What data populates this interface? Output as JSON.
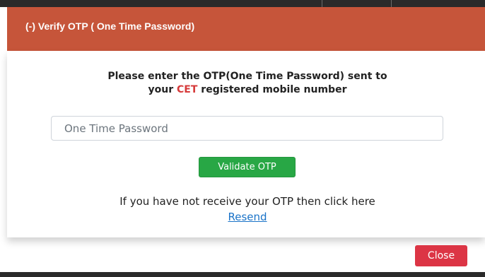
{
  "dialog": {
    "title": "(-) Verify OTP ( One Time Password)",
    "instruction_part1": "Please enter the OTP(One Time Password) sent to",
    "instruction_part2_prefix": "your ",
    "instruction_highlight": "CET",
    "instruction_part2_suffix": " registered mobile number",
    "otp_placeholder": "One Time Password",
    "otp_value": "",
    "validate_label": "Validate OTP",
    "resend_prompt": "If you have not receive your OTP then click here",
    "resend_link": "Resend",
    "close_label": "Close"
  },
  "colors": {
    "header": "#c6553a",
    "validate_button": "#28a745",
    "close_button": "#dc3545",
    "highlight": "#d63a3a",
    "link": "#1a73c8"
  }
}
